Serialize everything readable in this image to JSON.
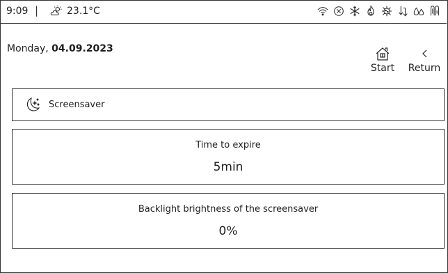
{
  "status": {
    "time": "9:09",
    "separator": "|",
    "temperature": "23.1°C",
    "icons": [
      "sun-cloud-icon",
      "wifi-icon",
      "x-circle-icon",
      "snowflake-icon",
      "flame-icon",
      "virus-icon",
      "arrows-down-icon",
      "drops-icon",
      "thermostat-icon"
    ]
  },
  "header": {
    "weekday": "Monday, ",
    "date": "04.09.2023",
    "start_label": "Start",
    "return_label": "Return"
  },
  "screensaver": {
    "label": "Screensaver"
  },
  "settings": {
    "expire_title": "Time to expire",
    "expire_value": "5min",
    "brightness_title": "Backlight brightness of the screensaver",
    "brightness_value": "0%"
  }
}
